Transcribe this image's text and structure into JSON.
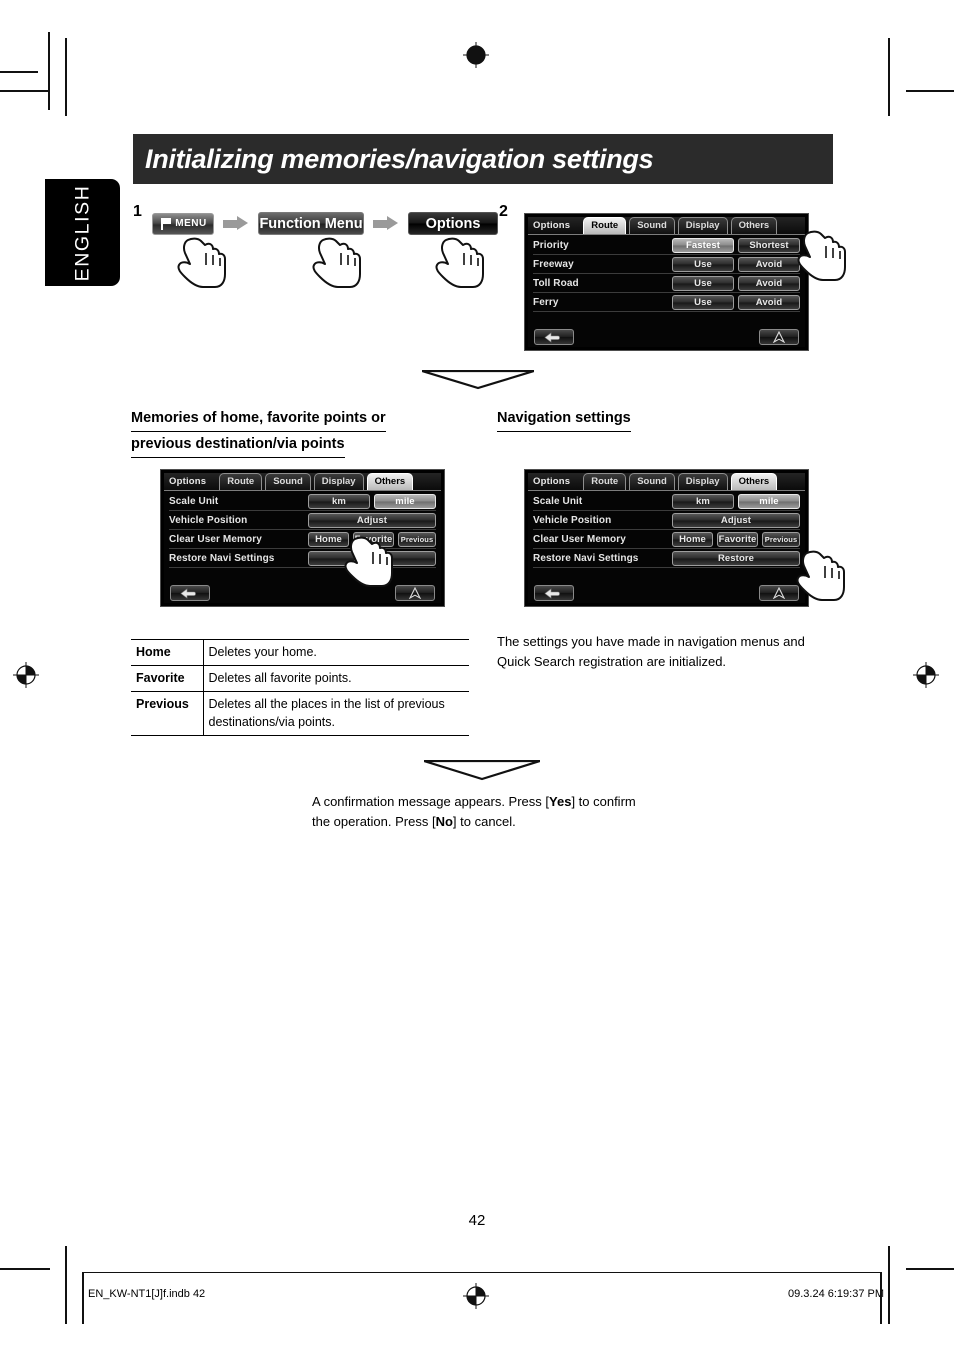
{
  "page": {
    "title": "Initializing memories/navigation settings",
    "language_tab": "ENGLISH",
    "page_number": "42"
  },
  "steps": {
    "one_number": "1",
    "two_number": "2",
    "flow": {
      "menu_button": "MENU",
      "menu_icon": "flag-icon",
      "arrow_icon": "right-arrow-icon",
      "function_menu_button": "Function Menu",
      "options_button": "Options"
    }
  },
  "screen_route": {
    "title": "Options",
    "tabs": [
      {
        "label": "Route",
        "active": true
      },
      {
        "label": "Sound",
        "active": false
      },
      {
        "label": "Display",
        "active": false
      },
      {
        "label": "Others",
        "active": false
      }
    ],
    "rows": [
      {
        "label": "Priority",
        "buttons": [
          {
            "text": "Fastest",
            "lit": true
          },
          {
            "text": "Shortest",
            "lit": false
          }
        ]
      },
      {
        "label": "Freeway",
        "buttons": [
          {
            "text": "Use",
            "lit": false
          },
          {
            "text": "Avoid",
            "lit": false
          }
        ]
      },
      {
        "label": "Toll Road",
        "buttons": [
          {
            "text": "Use",
            "lit": false
          },
          {
            "text": "Avoid",
            "lit": false
          }
        ]
      },
      {
        "label": "Ferry",
        "buttons": [
          {
            "text": "Use",
            "lit": false
          },
          {
            "text": "Avoid",
            "lit": false
          }
        ]
      }
    ],
    "footer": {
      "back_icon": "back-arrow-icon",
      "navi_icon": "navigation-compass-icon"
    }
  },
  "screen_others_left": {
    "title": "Options",
    "tabs": [
      {
        "label": "Route",
        "active": false
      },
      {
        "label": "Sound",
        "active": false
      },
      {
        "label": "Display",
        "active": false
      },
      {
        "label": "Others",
        "active": true
      }
    ],
    "rows": [
      {
        "label": "Scale Unit",
        "buttons": [
          {
            "text": "km",
            "lit": false
          },
          {
            "text": "mile",
            "lit": true
          }
        ]
      },
      {
        "label": "Vehicle Position",
        "buttons": [
          {
            "text": "Adjust",
            "lit": false
          }
        ]
      },
      {
        "label": "Clear User Memory",
        "buttons": [
          {
            "text": "Home",
            "lit": false
          },
          {
            "text": "Favorite",
            "lit": false
          },
          {
            "text": "Previous",
            "lit": false
          }
        ]
      },
      {
        "label": "Restore Navi Settings",
        "buttons": [
          {
            "text": "Restore",
            "lit": false
          }
        ]
      }
    ],
    "footer": {
      "back_icon": "back-arrow-icon",
      "navi_icon": "navigation-compass-icon"
    }
  },
  "screen_others_right": {
    "title": "Options",
    "tabs": [
      {
        "label": "Route",
        "active": false
      },
      {
        "label": "Sound",
        "active": false
      },
      {
        "label": "Display",
        "active": false
      },
      {
        "label": "Others",
        "active": true
      }
    ],
    "rows": [
      {
        "label": "Scale Unit",
        "buttons": [
          {
            "text": "km",
            "lit": false
          },
          {
            "text": "mile",
            "lit": true
          }
        ]
      },
      {
        "label": "Vehicle Position",
        "buttons": [
          {
            "text": "Adjust",
            "lit": false
          }
        ]
      },
      {
        "label": "Clear User Memory",
        "buttons": [
          {
            "text": "Home",
            "lit": false
          },
          {
            "text": "Favorite",
            "lit": false
          },
          {
            "text": "Previous",
            "lit": false
          }
        ]
      },
      {
        "label": "Restore Navi Settings",
        "buttons": [
          {
            "text": "Restore",
            "lit": false
          }
        ]
      }
    ],
    "footer": {
      "back_icon": "back-arrow-icon",
      "navi_icon": "navigation-compass-icon"
    }
  },
  "section_left": {
    "heading_line1": "Memories of home, favorite points or",
    "heading_line2": "previous destination/via points",
    "table": {
      "rows": [
        {
          "key": "Home",
          "desc": "Deletes your home."
        },
        {
          "key": "Favorite",
          "desc": "Deletes all favorite points."
        },
        {
          "key": "Previous",
          "desc": "Deletes all the places in the list of previous destinations/via points."
        }
      ]
    }
  },
  "section_right": {
    "heading": "Navigation settings",
    "body_line1": "The settings you have made in navigation menus and",
    "body_line2": "Quick Search registration are initialized."
  },
  "confirmation": {
    "line1_a": "A confirmation message appears. Press [",
    "line1_yes": "Yes",
    "line1_b": "] to confirm",
    "line2_a": "the operation. Press [",
    "line2_no": "No",
    "line2_b": "] to cancel."
  },
  "footer": {
    "file": "EN_KW-NT1[J]f.indb   42",
    "timestamp": "09.3.24   6:19:37 PM"
  },
  "colors": {
    "title_bar": "#2b2b2b",
    "tab_black": "#000000",
    "page_bg": "#ffffff"
  }
}
